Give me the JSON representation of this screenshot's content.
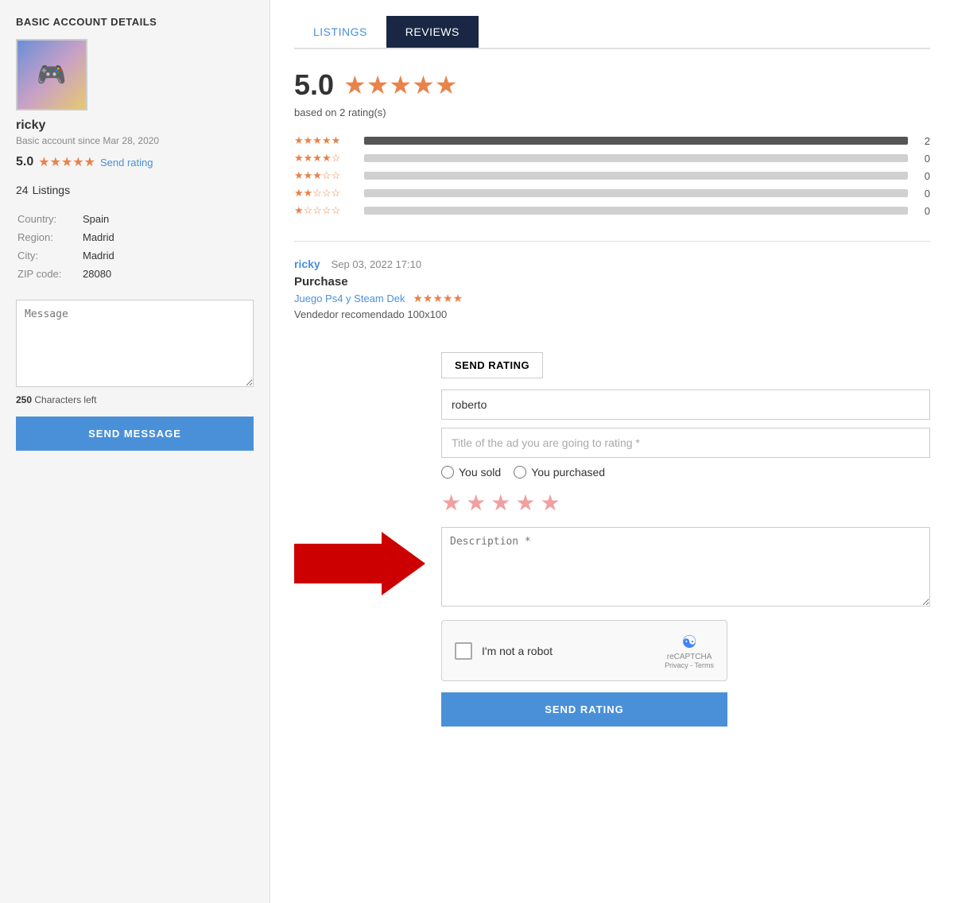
{
  "sidebar": {
    "title": "BASIC ACCOUNT DETAILS",
    "avatar_alt": "User avatar",
    "username": "ricky",
    "account_since": "Basic account since Mar 28, 2020",
    "rating_score": "5.0",
    "send_rating_label": "Send rating",
    "listings_count": "24",
    "listings_label": "Listings",
    "info": {
      "country_label": "Country:",
      "country_value": "Spain",
      "region_label": "Region:",
      "region_value": "Madrid",
      "city_label": "City:",
      "city_value": "Madrid",
      "zip_label": "ZIP code:",
      "zip_value": "28080"
    },
    "message_placeholder": "Message",
    "chars_left_count": "250",
    "chars_left_label": "Characters left",
    "send_message_btn": "SEND MESSAGE"
  },
  "tabs": {
    "listings_label": "LISTINGS",
    "reviews_label": "REVIEWS"
  },
  "reviews": {
    "score": "5.0",
    "based_on": "based on 2 rating(s)",
    "bars": [
      {
        "stars": "★★★★★",
        "pct": 100,
        "count": "2"
      },
      {
        "stars": "★★★★☆",
        "pct": 0,
        "count": "0"
      },
      {
        "stars": "★★★☆☆",
        "pct": 0,
        "count": "0"
      },
      {
        "stars": "★★☆☆☆",
        "pct": 0,
        "count": "0"
      },
      {
        "stars": "★☆☆☆☆",
        "pct": 0,
        "count": "0"
      }
    ],
    "review": {
      "reviewer": "ricky",
      "date": "Sep 03, 2022 17:10",
      "type": "Purchase",
      "listing": "Juego Ps4 y Steam Dek",
      "listing_stars": "★★★★★",
      "text": "Vendedor recomendado 100x100"
    }
  },
  "send_rating_form": {
    "header_btn": "SEND RATING",
    "username_value": "roberto",
    "title_placeholder": "Title of the ad you are going to rating *",
    "radio_sold": "You sold",
    "radio_purchased": "You purchased",
    "stars": [
      "★",
      "★",
      "★",
      "★",
      "★"
    ],
    "description_placeholder": "Description *",
    "captcha_text": "I'm not a robot",
    "captcha_brand": "reCAPTCHA",
    "captcha_links": "Privacy - Terms",
    "send_btn": "SEND RATING"
  }
}
